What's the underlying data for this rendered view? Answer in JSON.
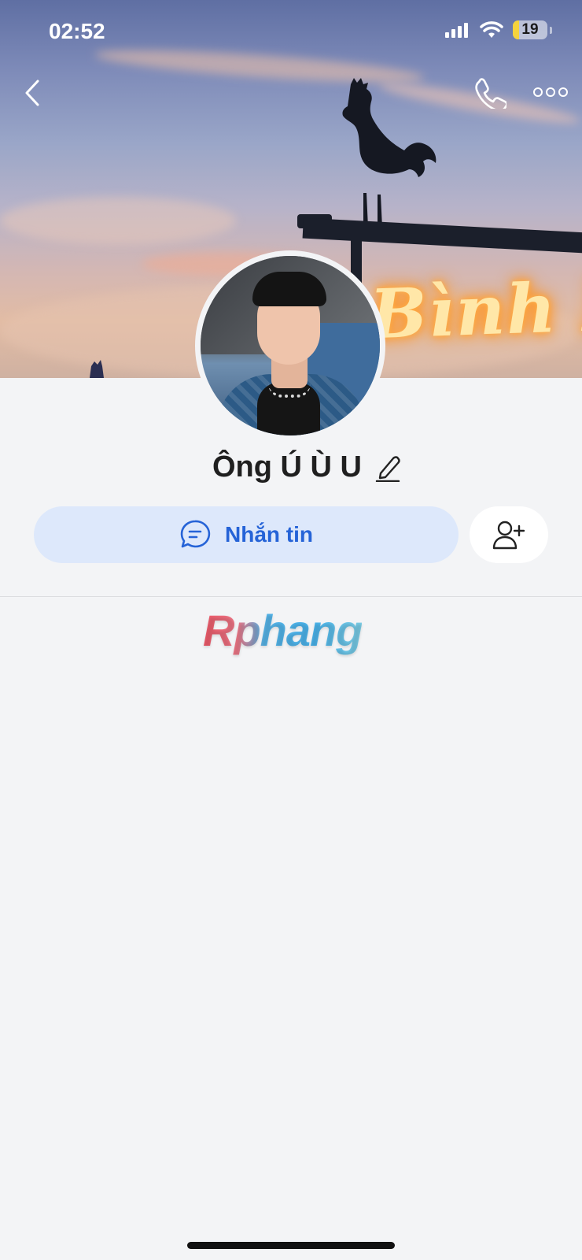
{
  "status_bar": {
    "time": "02:52",
    "battery_level": "19",
    "battery_fraction": 0.19,
    "icons": [
      "cellular-signal-icon",
      "wifi-icon",
      "battery-icon"
    ]
  },
  "cover": {
    "sign_text": "Bình Minh"
  },
  "nav": {
    "icons": [
      "chevron-left-icon",
      "phone-icon",
      "more-icon"
    ]
  },
  "profile": {
    "name": "Ông Ú Ù U"
  },
  "actions": {
    "message_label": "Nhắn tin",
    "message_icon": "chat-bubble-icon",
    "add_friend_icon": "add-user-icon"
  },
  "watermark": {
    "text": "Rphang"
  },
  "colors": {
    "accent": "#2563d7",
    "message_button_bg": "#dde8fb",
    "background": "#f3f4f6",
    "battery_fill": "#f6d33c"
  }
}
